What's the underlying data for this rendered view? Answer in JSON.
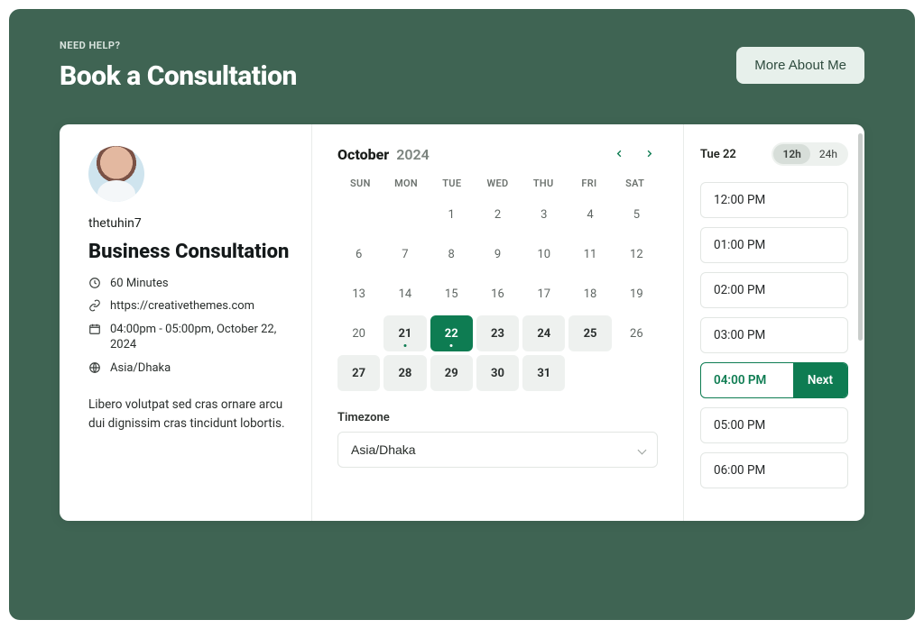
{
  "header": {
    "eyebrow": "NEED HELP?",
    "title": "Book a Consultation",
    "more_btn": "More About Me"
  },
  "info": {
    "username": "thetuhin7",
    "service_title": "Business Consultation",
    "duration": "60 Minutes",
    "link": "https://creativethemes.com",
    "scheduled": "04:00pm - 05:00pm, October 22, 2024",
    "timezone": "Asia/Dhaka",
    "description": "Libero volutpat sed cras ornare arcu dui dignissim cras tincidunt lobortis."
  },
  "calendar": {
    "month": "October",
    "year": "2024",
    "dow": [
      "SUN",
      "MON",
      "TUE",
      "WED",
      "THU",
      "FRI",
      "SAT"
    ],
    "cells": [
      {
        "n": ""
      },
      {
        "n": ""
      },
      {
        "n": "1"
      },
      {
        "n": "2"
      },
      {
        "n": "3"
      },
      {
        "n": "4"
      },
      {
        "n": "5"
      },
      {
        "n": "6"
      },
      {
        "n": "7"
      },
      {
        "n": "8"
      },
      {
        "n": "9"
      },
      {
        "n": "10"
      },
      {
        "n": "11"
      },
      {
        "n": "12"
      },
      {
        "n": "13"
      },
      {
        "n": "14"
      },
      {
        "n": "15"
      },
      {
        "n": "16"
      },
      {
        "n": "17"
      },
      {
        "n": "18"
      },
      {
        "n": "19"
      },
      {
        "n": "20"
      },
      {
        "n": "21",
        "cls": "avail dot-green"
      },
      {
        "n": "22",
        "cls": "today"
      },
      {
        "n": "23",
        "cls": "avail"
      },
      {
        "n": "24",
        "cls": "avail"
      },
      {
        "n": "25",
        "cls": "avail"
      },
      {
        "n": "26"
      },
      {
        "n": "27",
        "cls": "avail"
      },
      {
        "n": "28",
        "cls": "avail"
      },
      {
        "n": "29",
        "cls": "avail"
      },
      {
        "n": "30",
        "cls": "avail"
      },
      {
        "n": "31",
        "cls": "avail"
      },
      {
        "n": ""
      },
      {
        "n": ""
      }
    ],
    "tz_label": "Timezone",
    "tz_value": "Asia/Dhaka"
  },
  "slots": {
    "day_label": "Tue 22",
    "fmt12": "12h",
    "fmt24": "24h",
    "next_label": "Next",
    "list": [
      {
        "t": "12:00 PM"
      },
      {
        "t": "01:00 PM"
      },
      {
        "t": "02:00 PM"
      },
      {
        "t": "03:00 PM"
      },
      {
        "t": "04:00 PM",
        "sel": true
      },
      {
        "t": "05:00 PM"
      },
      {
        "t": "06:00 PM"
      }
    ]
  }
}
